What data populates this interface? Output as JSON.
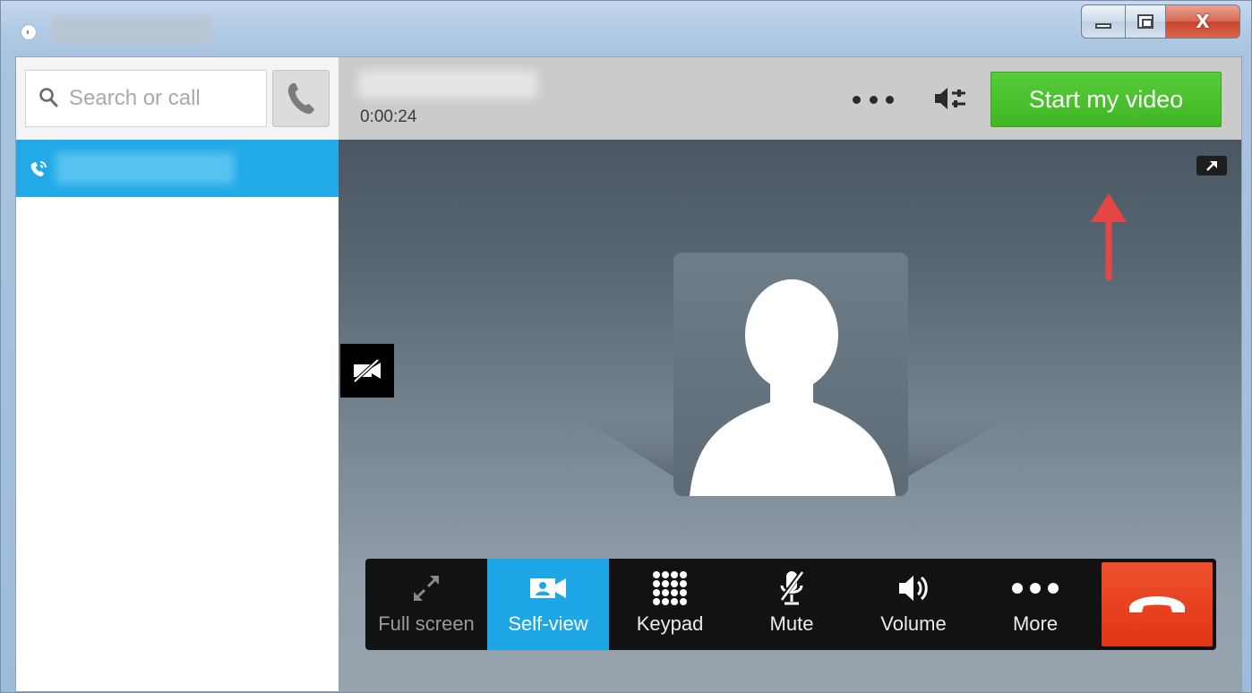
{
  "window": {
    "controls": [
      "minimize",
      "maximize",
      "close"
    ],
    "close_glyph": "X"
  },
  "search": {
    "placeholder": "Search or call",
    "icon": "search-icon"
  },
  "sidebar": {
    "active_call_icon": "phone-ringing-icon",
    "selected_color": "#21a9e8"
  },
  "call": {
    "duration": "0:00:24",
    "start_video_label": "Start my video",
    "start_video_color": "#4cc22e"
  },
  "controls": [
    {
      "id": "fullscreen",
      "label": "Full screen",
      "icon": "fullscreen-icon",
      "state": "disabled"
    },
    {
      "id": "self-view",
      "label": "Self-view",
      "icon": "video-camera-icon",
      "state": "active"
    },
    {
      "id": "keypad",
      "label": "Keypad",
      "icon": "keypad-icon",
      "state": "normal"
    },
    {
      "id": "mute",
      "label": "Mute",
      "icon": "microphone-muted-icon",
      "state": "normal"
    },
    {
      "id": "volume",
      "label": "Volume",
      "icon": "speaker-icon",
      "state": "normal"
    },
    {
      "id": "more",
      "label": "More",
      "icon": "more-dots-icon",
      "state": "normal"
    }
  ],
  "end_call": {
    "icon": "hang-up-icon",
    "color": "#e8401d"
  },
  "colors": {
    "accent_blue": "#1ea7e6",
    "annotation_arrow": "#e64545"
  }
}
